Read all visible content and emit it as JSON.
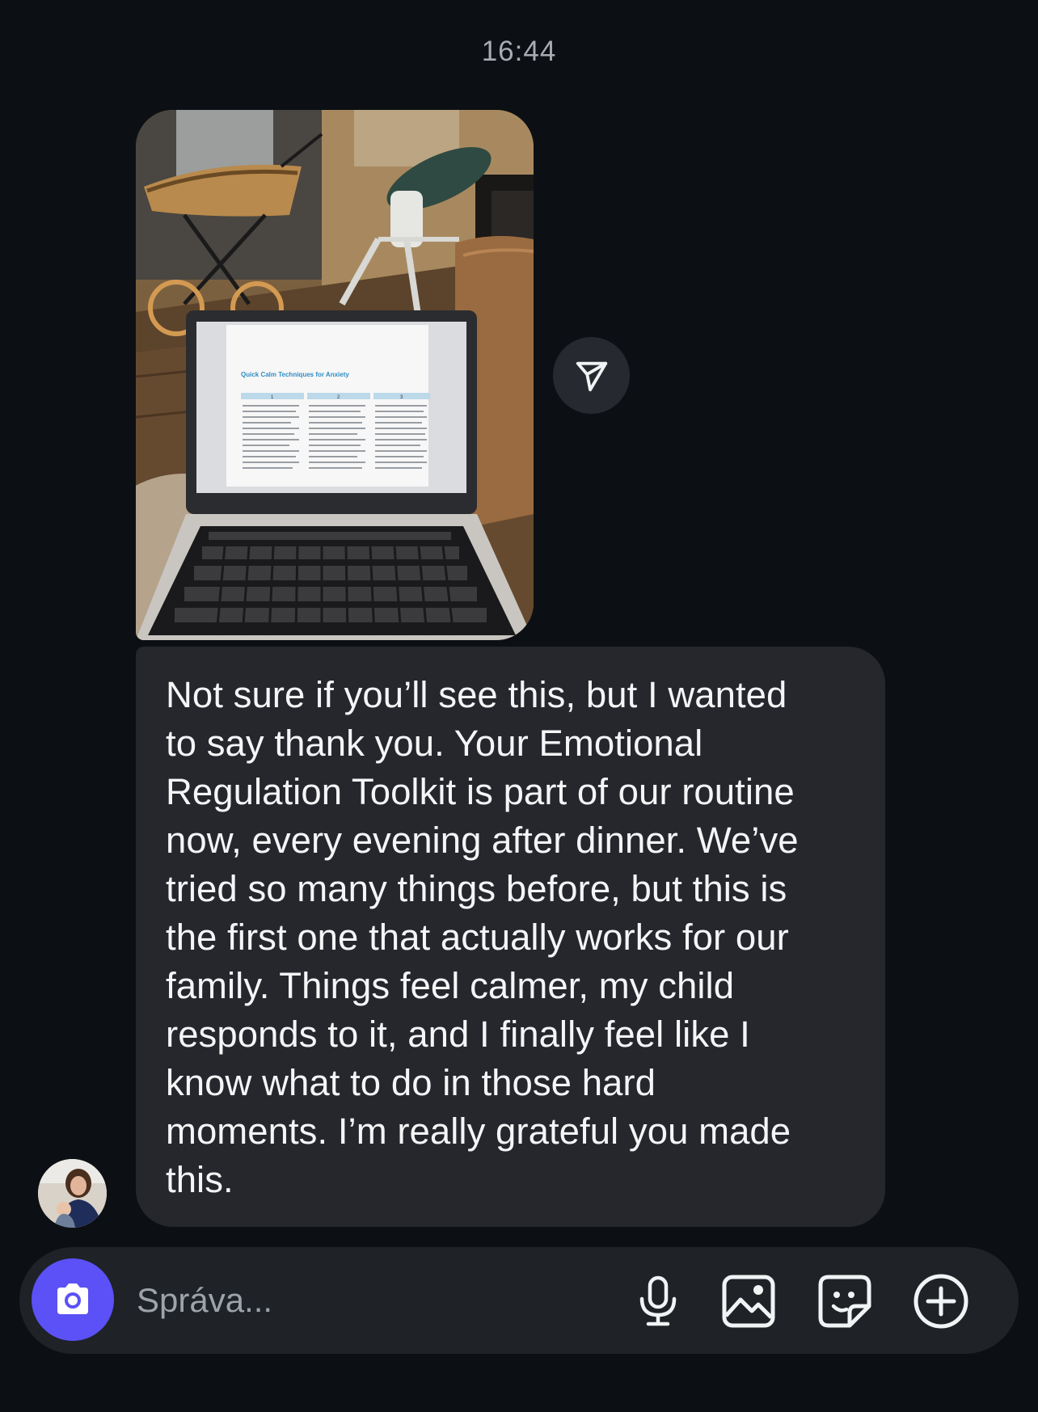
{
  "thread": {
    "timestamp": "16:44",
    "photo_message": {
      "screen_document_title": "Quick Calm Techniques for Anxiety",
      "screen_column_numbers": [
        "1",
        "2",
        "3"
      ]
    },
    "text_message": {
      "lines": [
        "Not sure if you’ll see this, but I wanted",
        "to say thank you. Your Emotional",
        "Regulation Toolkit is part of our routine",
        "now, every evening after dinner. We’ve",
        "tried so many things before, but this is",
        "the first one that actually works for our",
        "family. Things feel calmer, my child",
        "responds to it, and I finally feel like I",
        "know what to do in those hard",
        "moments. I’m really grateful you made",
        "this."
      ]
    }
  },
  "icons": {
    "share": "paper-plane-icon",
    "camera": "camera-icon",
    "mic": "microphone-icon",
    "gallery": "image-icon",
    "sticker": "sticker-icon",
    "more": "plus-circle-icon"
  },
  "composer": {
    "placeholder": "Správa..."
  },
  "colors": {
    "background": "#0c1014",
    "bubble": "#25272c",
    "accent": "#5b51f6",
    "composer": "#1f2227"
  }
}
